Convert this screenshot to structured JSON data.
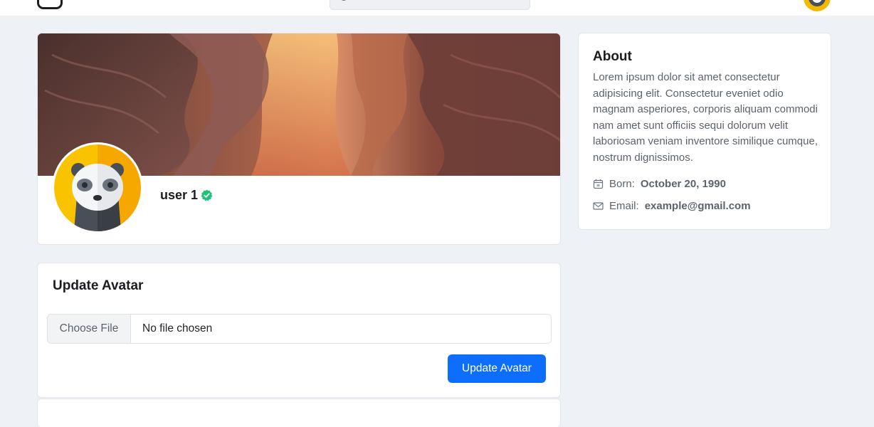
{
  "profile": {
    "username": "user 1"
  },
  "update_avatar": {
    "title": "Update Avatar",
    "file_button_label": "Choose File",
    "file_status": "No file chosen",
    "submit_label": "Update Avatar"
  },
  "about": {
    "title": "About",
    "description": "Lorem ipsum dolor sit amet consectetur adipisicing elit. Consectetur eveniet odio magnam asperiores, corporis aliquam commodi nam amet sunt officiis sequi dolorum velit laboriosam veniam inventore similique cumque, nostrum dignissimos.",
    "born_label": "Born:",
    "born_value": "October 20, 1990",
    "email_label": "Email:",
    "email_value": "example@gmail.com"
  },
  "icons": {
    "logo": "instagram-logo-icon",
    "search": "search-icon",
    "verified": "verified-check-icon",
    "calendar": "calendar-icon",
    "email": "envelope-icon"
  },
  "colors": {
    "primary": "#0d6efd",
    "verified": "#20c27a",
    "page_bg": "#eef1f6"
  }
}
